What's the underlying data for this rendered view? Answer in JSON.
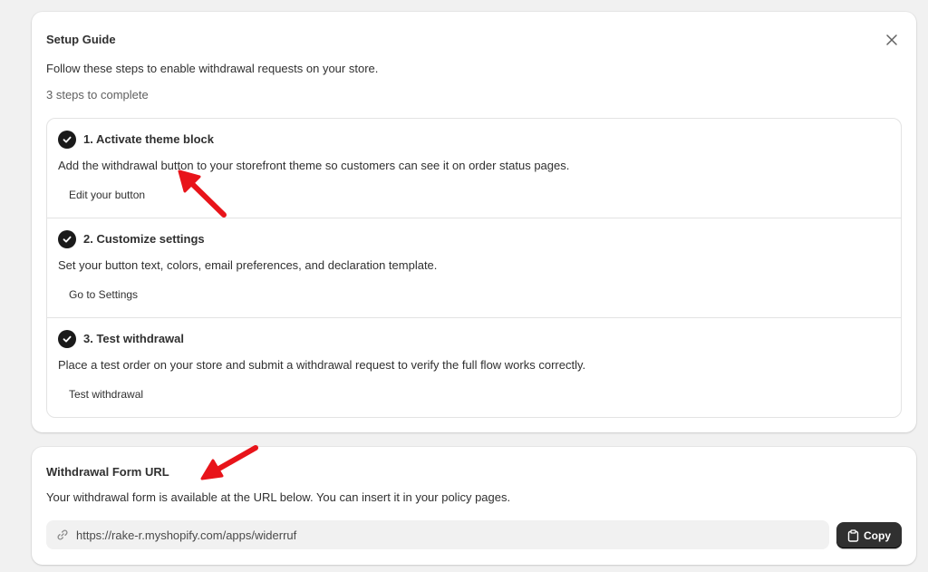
{
  "setup_guide": {
    "title": "Setup Guide",
    "description": "Follow these steps to enable withdrawal requests on your store.",
    "progress": "3 steps to complete",
    "close_icon": "close-icon",
    "steps": [
      {
        "title": "1. Activate theme block",
        "description": "Add the withdrawal button to your storefront theme so customers can see it on order status pages.",
        "action": "Edit your button",
        "completed": true
      },
      {
        "title": "2. Customize settings",
        "description": "Set your button text, colors, email preferences, and declaration template.",
        "action": "Go to Settings",
        "completed": true
      },
      {
        "title": "3. Test withdrawal",
        "description": "Place a test order on your store and submit a withdrawal request to verify the full flow works correctly.",
        "action": "Test withdrawal",
        "completed": true
      }
    ]
  },
  "withdrawal_form": {
    "title": "Withdrawal Form URL",
    "description": "Your withdrawal form is available at the URL below. You can insert it in your policy pages.",
    "url": "https://rake-r.myshopify.com/apps/widerruf",
    "url_icon": "link-icon",
    "copy_label": "Copy",
    "copy_icon": "clipboard-icon"
  },
  "colors": {
    "page_background": "#f1f1f1",
    "card_background": "#ffffff",
    "check_fill": "#1a1a1a",
    "primary_button": "#303030",
    "annotation_arrow": "#e8141a"
  }
}
